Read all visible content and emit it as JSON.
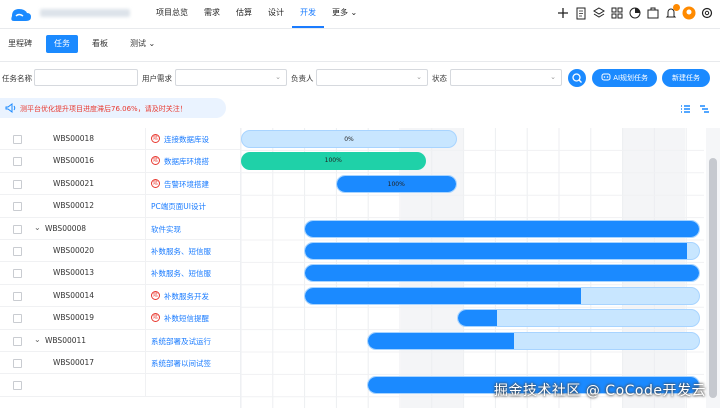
{
  "nav": {
    "items": [
      "项目总览",
      "需求",
      "估算",
      "设计",
      "开发",
      "更多"
    ],
    "active_index": 4
  },
  "subnav": {
    "items": [
      "里程碑",
      "任务",
      "看板",
      "测试"
    ],
    "active_index": 1
  },
  "filters": {
    "task_name_label": "任务名称",
    "user_story_label": "用户需求",
    "assignee_label": "负责人",
    "status_label": "状态",
    "ai_plan_label": "AI规划任务",
    "new_task_label": "新建任务"
  },
  "notice": "测平台优化提升项目进度滞后76.06%，请及时关注！",
  "rows": [
    {
      "code": "WBS00018",
      "name": "连接数据库设",
      "badge": "延",
      "level": 2,
      "bar": {
        "start": 0.0,
        "end": 0.48,
        "progress": 0,
        "label": "0%"
      }
    },
    {
      "code": "WBS00016",
      "name": "数据库环境搭",
      "badge": "延",
      "level": 2,
      "bar": {
        "start": 0.0,
        "end": 0.41,
        "progress": 100,
        "label": "100%",
        "done": true
      }
    },
    {
      "code": "WBS00021",
      "name": "告警环境搭建",
      "badge": "延",
      "level": 2,
      "bar": {
        "start": 0.21,
        "end": 0.48,
        "progress": 100,
        "label": "100%"
      }
    },
    {
      "code": "WBS00012",
      "name": "PC端页面UI设计",
      "badge": "",
      "level": 2,
      "bar": null
    },
    {
      "code": "WBS00008",
      "name": "软件实现",
      "badge": "",
      "level": 1,
      "expand": "⌄",
      "bar": {
        "start": 0.14,
        "end": 1.02,
        "progress": 100,
        "label": ""
      }
    },
    {
      "code": "WBS00020",
      "name": "补数服务、短信服",
      "badge": "",
      "level": 2,
      "bar": {
        "start": 0.14,
        "end": 1.02,
        "progress": 97,
        "label": ""
      }
    },
    {
      "code": "WBS00013",
      "name": "补数服务、短信服",
      "badge": "",
      "level": 2,
      "bar": {
        "start": 0.14,
        "end": 1.02,
        "progress": 100,
        "label": ""
      }
    },
    {
      "code": "WBS00014",
      "name": "补数服务开发",
      "badge": "延",
      "level": 2,
      "bar": {
        "start": 0.14,
        "end": 1.02,
        "progress": 70,
        "label": ""
      }
    },
    {
      "code": "WBS00019",
      "name": "补数短信提醒",
      "badge": "延",
      "level": 2,
      "bar": {
        "start": 0.48,
        "end": 1.02,
        "progress": 16,
        "label": ""
      }
    },
    {
      "code": "WBS00011",
      "name": "系统部署及试运行",
      "badge": "",
      "level": 1,
      "expand": "⌄",
      "bar": {
        "start": 0.28,
        "end": 1.02,
        "progress": 44,
        "label": ""
      }
    },
    {
      "code": "WBS00017",
      "name": "系统部署以间试签",
      "badge": "",
      "level": 2,
      "bar": null
    },
    {
      "code": "",
      "name": "",
      "badge": "",
      "level": 2,
      "bar": {
        "start": 0.28,
        "end": 1.02,
        "progress": 100,
        "label": ""
      }
    }
  ],
  "watermark": "掘金技术社区 @ CoCode开发云",
  "colors": {
    "accent": "#1b8aff",
    "done": "#1fd1a8",
    "remain": "#c8e6ff",
    "delay": "#e8382f"
  }
}
